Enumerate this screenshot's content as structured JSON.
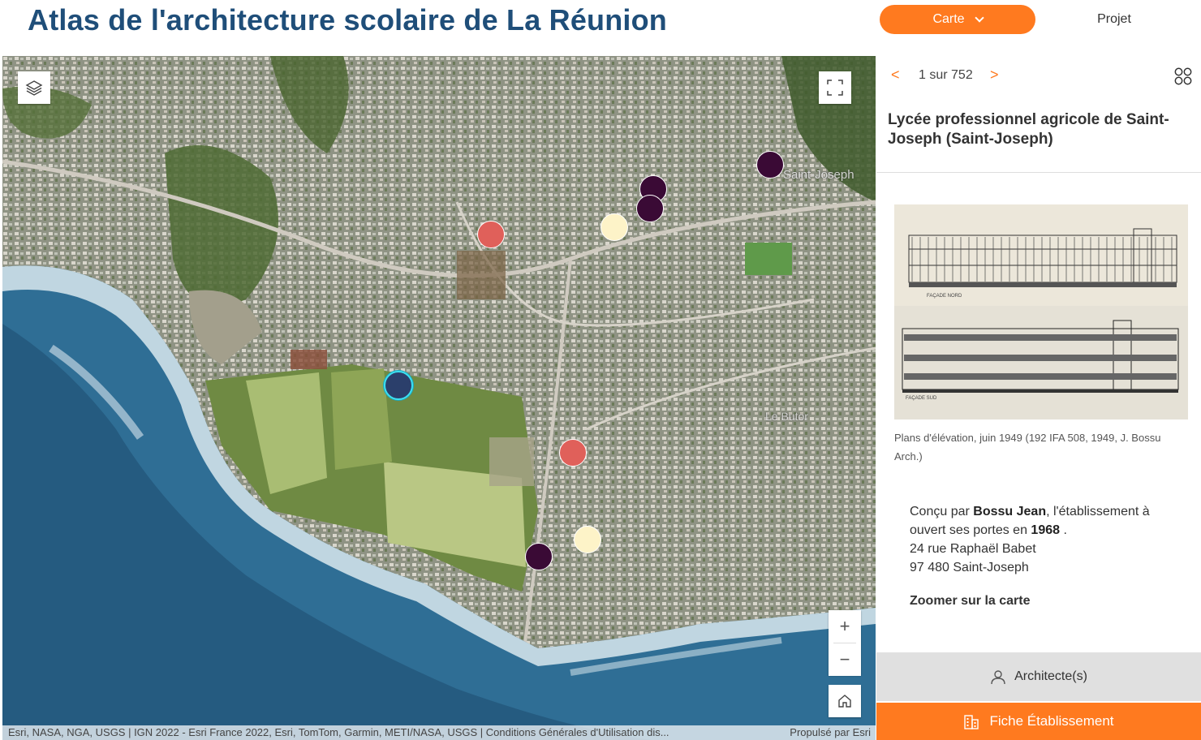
{
  "header": {
    "title": "Atlas de l'architecture scolaire de La Réunion",
    "nav_carte": "Carte",
    "nav_projet": "Projet"
  },
  "map": {
    "place_labels": [
      "Saint-Joseph",
      "Le Butor"
    ],
    "attribution": "Esri, NASA, NGA, USGS | IGN 2022 - Esri France 2022, Esri, TomTom, Garmin, METI/NASA, USGS | Conditions Générales d'Utilisation dis...",
    "powered_by": "Propulsé par Esri",
    "icons": {
      "layers": "layers-icon",
      "fullscreen": "fullscreen-icon",
      "zoom_in": "plus-icon",
      "zoom_out": "minus-icon",
      "home": "home-icon"
    },
    "marker_colors": {
      "selected": "#2b3f6b",
      "selected_ring": "#3ee0f0",
      "red": "#e0605a",
      "cream": "#fdf3c8",
      "dark": "#3a0a35"
    },
    "zoom_in_label": "+",
    "zoom_out_label": "−"
  },
  "panel": {
    "pager": {
      "prev": "<",
      "next": ">",
      "count": "1 sur 752"
    },
    "title": "Lycée professionnel agricole de Saint-Joseph (Saint-Joseph)",
    "image_labels": [
      "FAÇADE NORD",
      "FAÇADE SUD"
    ],
    "caption": "Plans d'élévation, juin 1949 (192 IFA 508, 1949, J. Bossu Arch.)",
    "details": {
      "designed_by_prefix": "Conçu par",
      "architect": "Bossu Jean",
      "opened_mid": ", l'établissement à ouvert ses portes en",
      "year": "1968",
      "period": ".",
      "address_line1": "24 rue Raphaël Babet",
      "address_line2": "97 480 Saint-Joseph"
    },
    "zoom_link": "Zoomer sur la carte",
    "btn_architects": "Architecte(s)",
    "btn_fiche": "Fiche Établissement"
  },
  "colors": {
    "brand_orange": "#ff7a1f",
    "title_blue": "#1f4e79"
  }
}
